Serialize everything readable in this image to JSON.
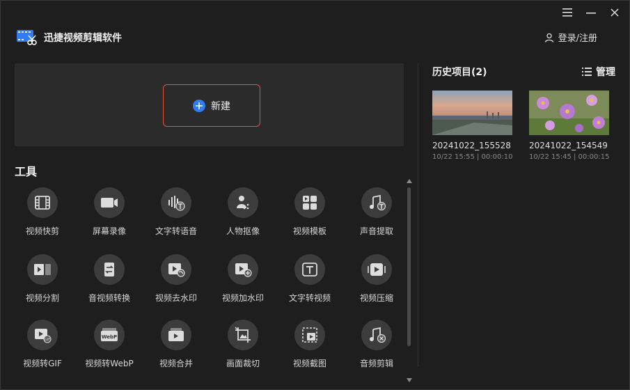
{
  "app": {
    "title": "迅捷视频剪辑软件",
    "login_label": "登录/注册"
  },
  "new_button": {
    "label": "新建"
  },
  "tools": {
    "heading": "工具",
    "items": [
      {
        "label": "视频快剪",
        "icon": "film-icon"
      },
      {
        "label": "屏幕录像",
        "icon": "camera-icon"
      },
      {
        "label": "文字转语音",
        "icon": "text-to-speech-icon"
      },
      {
        "label": "人物抠像",
        "icon": "portrait-cutout-icon"
      },
      {
        "label": "视频模板",
        "icon": "template-icon"
      },
      {
        "label": "声音提取",
        "icon": "audio-extract-icon"
      },
      {
        "label": "视频分割",
        "icon": "video-split-icon"
      },
      {
        "label": "音视频转换",
        "icon": "convert-icon"
      },
      {
        "label": "视频去水印",
        "icon": "remove-watermark-icon"
      },
      {
        "label": "视频加水印",
        "icon": "add-watermark-icon"
      },
      {
        "label": "文字转视频",
        "icon": "text-to-video-icon"
      },
      {
        "label": "视频压缩",
        "icon": "compress-icon"
      },
      {
        "label": "视频转GIF",
        "icon": "gif-icon"
      },
      {
        "label": "视频转WebP",
        "icon": "webp-icon"
      },
      {
        "label": "视频合并",
        "icon": "merge-icon"
      },
      {
        "label": "画面裁切",
        "icon": "crop-icon"
      },
      {
        "label": "视频截图",
        "icon": "screenshot-icon"
      },
      {
        "label": "音频剪辑",
        "icon": "audio-cut-icon"
      }
    ]
  },
  "history": {
    "title": "历史项目(2)",
    "manage_label": "管理",
    "projects": [
      {
        "name": "20241022_155528",
        "meta": "10/22 15:55 | 00:00:10"
      },
      {
        "name": "20241022_154549",
        "meta": "10/22 15:45 | 00:00:15"
      }
    ]
  },
  "colors": {
    "accent_blue": "#2f7cf6",
    "new_border": "#e5533d",
    "background": "#1e1e1e",
    "panel": "#2b2b2b"
  }
}
